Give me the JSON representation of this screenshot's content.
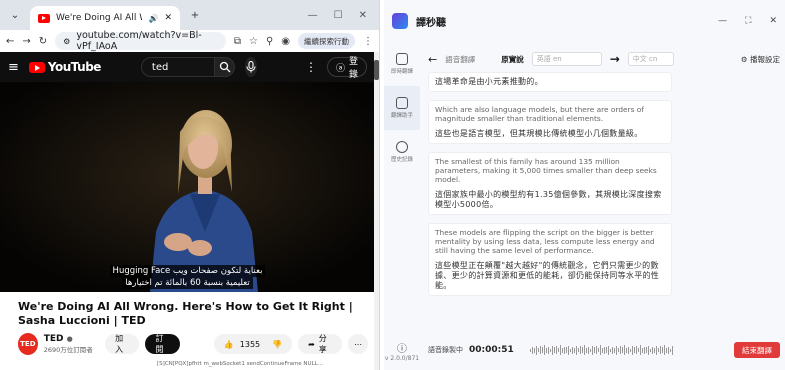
{
  "browser": {
    "tab_title": "We're Doing AI All Wrong",
    "url": "youtube.com/watch?v=Bl-vPf_IAoA",
    "resume_label": "繼續探索行動",
    "youtube": {
      "logo_text": "YouTube",
      "search_value": "ted",
      "signin_label": "登錄"
    },
    "captions": {
      "line1": "Hugging Face بعناية لتكون صفحات ويب",
      "line2": "تعليمية بنسبة 60 بالمائة تم اختيارها"
    },
    "video_title": "We're Doing AI All Wrong. Here's How to Get It Right | Sasha Luccioni | TED",
    "channel": {
      "logo": "TED",
      "name": "TED",
      "subscribers": "2690万位訂閱者",
      "join_label": "加入",
      "subscribe_label": "訂閱",
      "likes": "1355",
      "share_label": "分享"
    }
  },
  "app": {
    "title": "譯秒聽",
    "sidebar": [
      {
        "label": "即時翻譯",
        "icon": "monitor-icon",
        "active": false
      },
      {
        "label": "翻譯助手",
        "icon": "chat-icon",
        "active": true
      },
      {
        "label": "歷史記錄",
        "icon": "history-icon",
        "active": false
      }
    ],
    "version": "v 2.0.0/871",
    "toolbar": {
      "mode_label": "語音翻譯",
      "source_label": "原實說",
      "source_lang": "英語 en",
      "target_lang": "中文 cn",
      "settings_label": "播報設定"
    },
    "entries": [
      {
        "source": "",
        "translation": "這場革命是由小元素推動的。"
      },
      {
        "source": "Which are also language models, but there are orders of magnitude smaller than traditional elements.",
        "translation": "這些也是語言模型，但其規模比傳統模型小几個數量級。"
      },
      {
        "source": "The smallest of this family has around 135 million parameters, making it 5,000 times smaller than deep seeks model.",
        "translation": "這個家族中最小的模型約有1.35億個參數，其規模比深度搜索模型小5000倍。"
      },
      {
        "source": "These models are flipping the script on the bigger is better mentality by using less data, less compute less energy and still having the same level of performance.",
        "translation": "這些模型正在顛覆\"越大越好\"的傳統觀念，它們只需更少的數據、更少的計算資源和更低的能耗，卻仍能保持同等水平的性能。"
      }
    ],
    "recording_label": "語音錄製中",
    "timer": "00:00:51",
    "stop_label": "結束翻譯",
    "status": "[S]CN[PQX]pfhtt m_webSocket1 sendContinueFrame NULL..."
  }
}
